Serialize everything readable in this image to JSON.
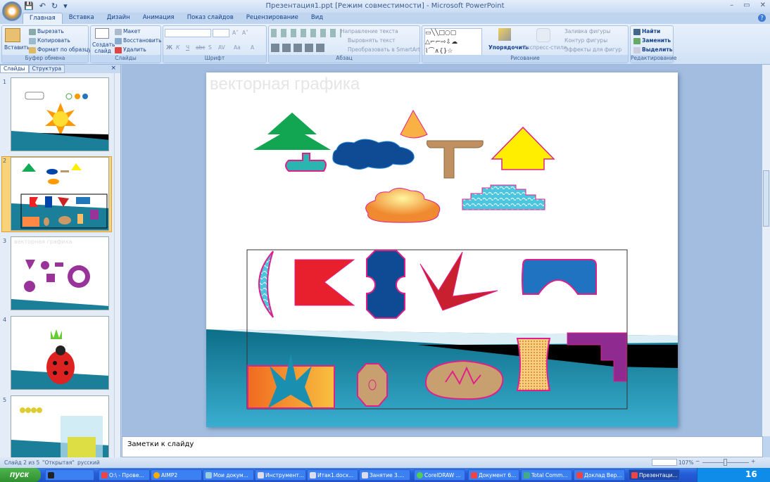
{
  "window": {
    "title": "Презентация1.ppt [Режим совместимости] - Microsoft PowerPoint",
    "minimize": "–",
    "restore": "▭",
    "close": "✕"
  },
  "qat": {
    "save": "💾",
    "undo": "↶",
    "redo": "↻",
    "more": "▾"
  },
  "tabs": [
    "Главная",
    "Вставка",
    "Дизайн",
    "Анимация",
    "Показ слайдов",
    "Рецензирование",
    "Вид"
  ],
  "help": "?",
  "ribbon": {
    "clipboard": {
      "label": "Буфер обмена",
      "paste": "Вставить",
      "cut": "Вырезать",
      "copy": "Копировать",
      "format": "Формат по образцу"
    },
    "slides": {
      "label": "Слайды",
      "new_slide": "Создать слайд",
      "layout": "Макет",
      "reset": "Восстановить",
      "delete": "Удалить"
    },
    "font": {
      "label": "Шрифт",
      "font_name": "",
      "font_size": "",
      "bold": "Ж",
      "italic": "К",
      "underline": "Ч",
      "strike": "abc",
      "shadow": "S",
      "spacing": "AV",
      "case": "Aa",
      "grow": "A˄",
      "shrink": "A˅",
      "color": "A"
    },
    "paragraph": {
      "label": "Абзац",
      "direction": "Направление текста",
      "align": "Выровнять текст",
      "smartart": "Преобразовать в SmartArt"
    },
    "drawing": {
      "label": "Рисование",
      "arrange": "Упорядочить",
      "styles": "Экспресс-стили",
      "fill": "Заливка фигуры",
      "outline": "Контур фигуры",
      "effects": "Эффекты для фигур"
    },
    "editing": {
      "label": "Редактирование",
      "find": "Найти",
      "replace": "Заменить",
      "select": "Выделить"
    }
  },
  "leftpane": {
    "tabs": [
      "Слайды",
      "Структура"
    ],
    "close": "×",
    "slides": [
      "1",
      "2",
      "3",
      "4",
      "5"
    ],
    "thumb3_title": "векторная графика"
  },
  "slide": {
    "title": "векторная графика"
  },
  "notes": {
    "placeholder": "Заметки к слайду"
  },
  "status": {
    "slide": "Слайд 2 из 5",
    "theme": "\"Открытая\"",
    "lang": "русский",
    "zoom": "107%",
    "zoom_minus": "−",
    "zoom_plus": "+"
  },
  "taskbar": {
    "start": "пуск",
    "items": [
      "О:\\ - Прове...",
      "AIMP2",
      "Мои докум...",
      "Инструмент...",
      "Итак1.docx...",
      "Занятие 3....",
      "CorelDRAW ...",
      "Документ 6...",
      "Total Comm...",
      "Доклад Вер...",
      "Презентаци..."
    ],
    "clock": "16"
  }
}
